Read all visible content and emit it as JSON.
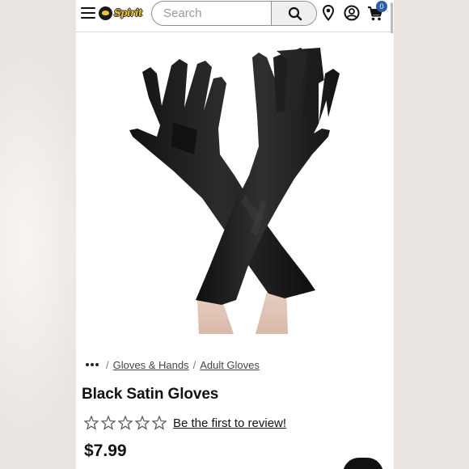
{
  "header": {
    "logo_text": "Spirit",
    "search_placeholder": "Search",
    "cart_count": "0"
  },
  "product": {
    "image_alt": "Black Satin Gloves",
    "breadcrumb": [
      {
        "label": "Gloves & Hands"
      },
      {
        "label": "Adult Gloves"
      }
    ],
    "title": "Black Satin Gloves",
    "rating_stars": 0,
    "review_link": "Be the first to review!",
    "price": "$7.99"
  },
  "colors": {
    "accent": "#2a5db0",
    "logo_yellow": "#f2c230",
    "glove": "#1b1b1b"
  },
  "icons": [
    "menu-icon",
    "spirit-logo",
    "search-icon",
    "location-pin-icon",
    "account-icon",
    "cart-icon",
    "star-outline-icon",
    "more-dots-icon"
  ]
}
